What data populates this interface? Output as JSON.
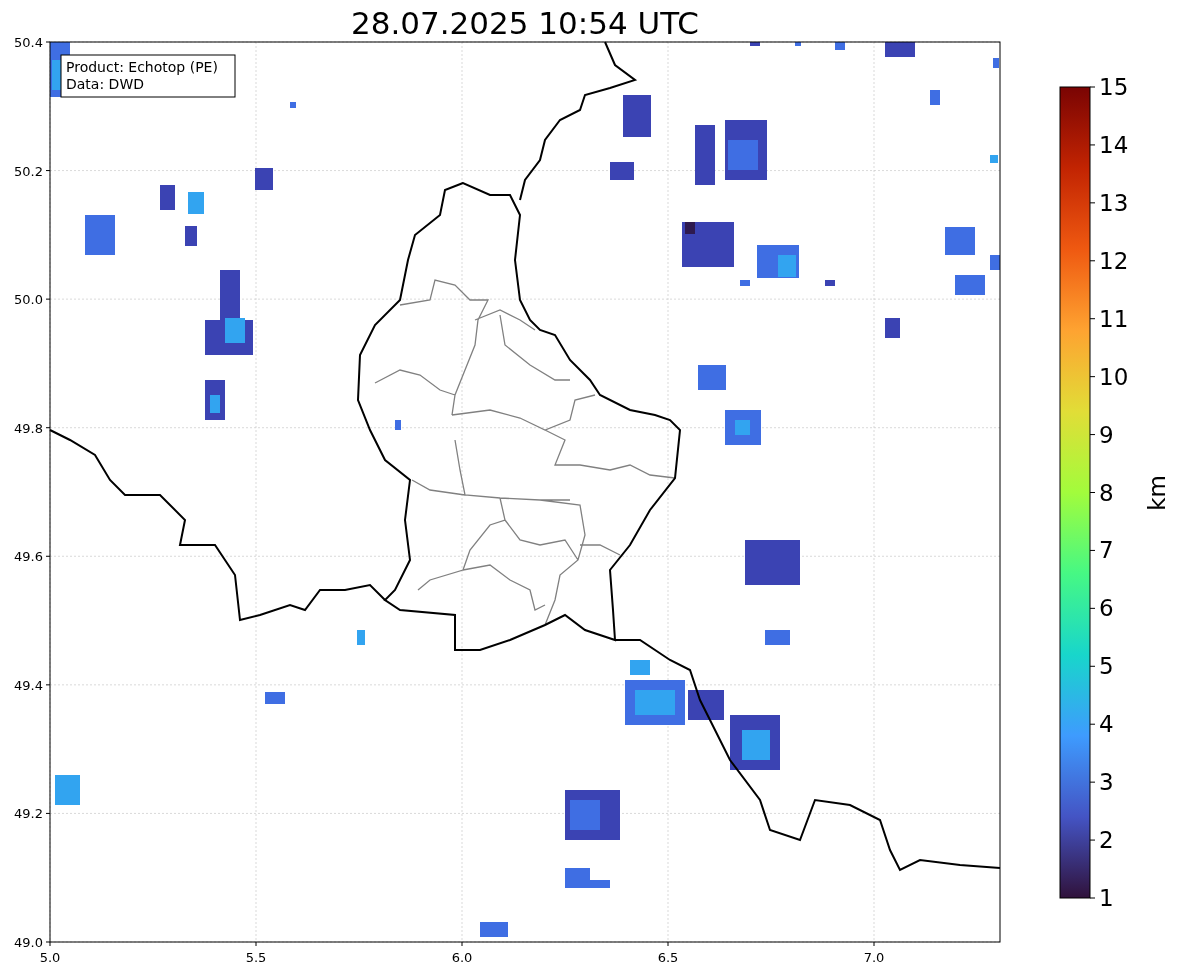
{
  "title": "28.07.2025 10:54 UTC",
  "info_box": {
    "lines": [
      "Product: Echotop (PE)",
      "Data: DWD"
    ]
  },
  "x_axis": {
    "ticks": [
      "5.0",
      "5.5",
      "6.0",
      "6.5",
      "7.0"
    ]
  },
  "y_axis": {
    "ticks": [
      "50.4",
      "50.2",
      "50.0",
      "49.8",
      "49.6",
      "49.4",
      "49.2",
      "49.0"
    ]
  },
  "colorbar": {
    "label": "km",
    "ticks": [
      "15",
      "14",
      "13",
      "12",
      "11",
      "10",
      "9",
      "8",
      "7",
      "6",
      "5",
      "4",
      "3",
      "2",
      "1"
    ]
  }
}
